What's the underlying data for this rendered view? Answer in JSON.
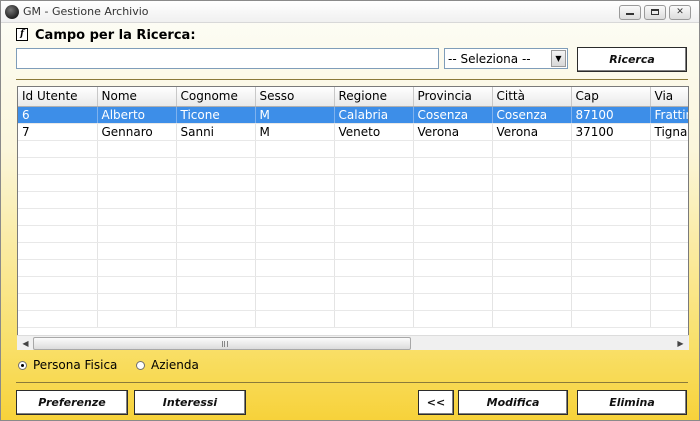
{
  "window": {
    "title": "GM - Gestione Archivio",
    "app_icon": "globe-icon",
    "controls": {
      "minimize": "minimize-icon",
      "maximize": "maximize-icon",
      "close": "✕"
    }
  },
  "search": {
    "field_icon": "f",
    "label": "Campo per la Ricerca:",
    "input_value": "",
    "select_value": "-- Seleziona --",
    "button_label": "Ricerca"
  },
  "grid": {
    "columns": [
      "Id Utente",
      "Nome",
      "Cognome",
      "Sesso",
      "Regione",
      "Provincia",
      "Città",
      "Cap",
      "Via"
    ],
    "rows": [
      {
        "cells": [
          "6",
          "Alberto",
          "Ticone",
          "M",
          "Calabria",
          "Cosenza",
          "Cosenza",
          "87100",
          "Frattin"
        ],
        "selected": true
      },
      {
        "cells": [
          "7",
          "Gennaro",
          "Sanni",
          "M",
          "Veneto",
          "Verona",
          "Verona",
          "37100",
          "Tigna"
        ],
        "selected": false
      }
    ],
    "empty_rows": 11,
    "selection_color": "#3d8ee8"
  },
  "radios": {
    "persona": {
      "label": "Persona Fisica",
      "checked": true
    },
    "azienda": {
      "label": "Azienda",
      "checked": false
    }
  },
  "buttons": {
    "preferenze": "Preferenze",
    "interessi": "Interessi",
    "back": "<<",
    "modifica": "Modifica",
    "elimina": "Elimina"
  },
  "colors": {
    "background_top": "#fdfdf8",
    "background_bottom": "#f7d23a",
    "separator": "#8b7a3a"
  }
}
